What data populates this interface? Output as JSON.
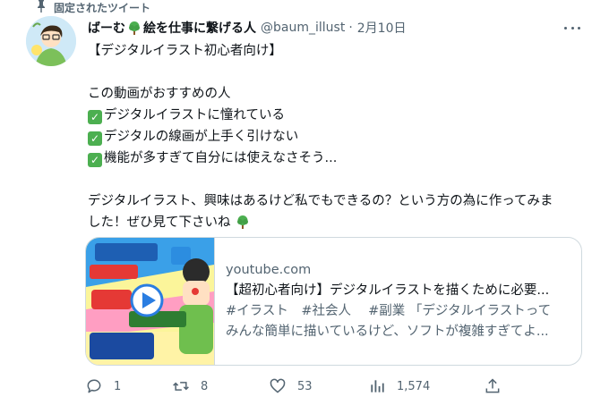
{
  "pinned_label": "固定されたツイート",
  "tweet": {
    "display_name_prefix": "ばーむ",
    "display_name_suffix": "絵を仕事に繋げる人",
    "handle": "@baum_illust",
    "separator": "·",
    "date": "2月10日",
    "lines": {
      "l1": "【デジタルイラスト初心者向け】",
      "l2": "",
      "l3": "この動画がおすすめの人",
      "l4": "デジタルイラストに憧れている",
      "l5": "デジタルの線画が上手く引けない",
      "l6": "機能が多すぎて自分には使えなさそう...",
      "l7": "",
      "l8": "デジタルイラスト、興味はあるけど私でもできるの？という方の為に作ってみま",
      "l9": "した！ぜひ見て下さいね"
    }
  },
  "link_card": {
    "domain": "youtube.com",
    "title": "【超初心者向け】デジタルイラストを描くために必要...",
    "desc_line1": "#イラスト　#社会人　 #副業 「デジタルイラストって",
    "desc_line2": "みんな簡単に描いているけど、ソフトが複雑すぎてよ..."
  },
  "actions": {
    "reply_count": "1",
    "retweet_count": "8",
    "like_count": "53",
    "view_count": "1,574"
  }
}
